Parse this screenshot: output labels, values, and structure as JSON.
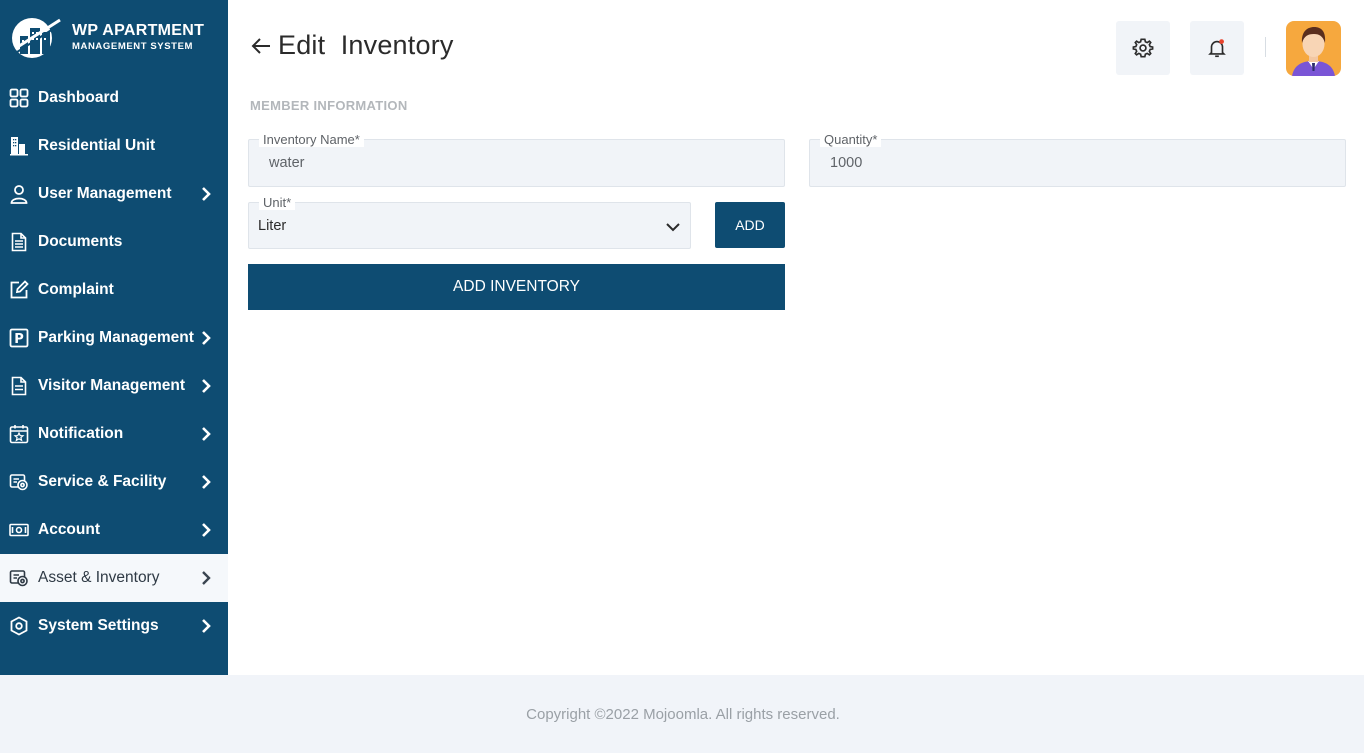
{
  "brand": {
    "title": "WP APARTMENT",
    "subtitle": "MANAGEMENT SYSTEM"
  },
  "sidebar": {
    "items": [
      {
        "label": "Dashboard",
        "icon": "dashboard-grid-icon",
        "has_submenu": false,
        "active": false
      },
      {
        "label": "Residential Unit",
        "icon": "building-icon",
        "has_submenu": false,
        "active": false
      },
      {
        "label": "User Management",
        "icon": "user-icon",
        "has_submenu": true,
        "active": false
      },
      {
        "label": "Documents",
        "icon": "document-icon",
        "has_submenu": false,
        "active": false
      },
      {
        "label": "Complaint",
        "icon": "edit-icon",
        "has_submenu": false,
        "active": false
      },
      {
        "label": "Parking Management",
        "icon": "parking-icon",
        "has_submenu": true,
        "active": false
      },
      {
        "label": "Visitor Management",
        "icon": "visitor-document-icon",
        "has_submenu": true,
        "active": false
      },
      {
        "label": "Notification",
        "icon": "calendar-star-icon",
        "has_submenu": true,
        "active": false
      },
      {
        "label": "Service & Facility",
        "icon": "service-icon",
        "has_submenu": true,
        "active": false
      },
      {
        "label": "Account",
        "icon": "money-icon",
        "has_submenu": true,
        "active": false
      },
      {
        "label": "Asset & Inventory",
        "icon": "asset-icon",
        "has_submenu": true,
        "active": true
      },
      {
        "label": "System Settings",
        "icon": "settings-hex-icon",
        "has_submenu": true,
        "active": false
      }
    ]
  },
  "header": {
    "title": "Edit  Inventory",
    "icons": [
      "gear-icon",
      "bell-icon"
    ],
    "bell_has_badge": true
  },
  "form": {
    "section_title": "MEMBER INFORMATION",
    "inventory_name": {
      "label": "Inventory Name*",
      "value": "water"
    },
    "quantity": {
      "label": "Quantity*",
      "value": "1000"
    },
    "unit": {
      "label": "Unit*",
      "value": "Liter"
    },
    "add_button": "ADD",
    "submit_button": "ADD INVENTORY"
  },
  "footer": {
    "copyright": "Copyright ©2022 Mojoomla. All rights reserved."
  },
  "colors": {
    "primary": "#0e4c72",
    "field_bg": "#f1f4f8",
    "active_item_bg": "#f5f8fb",
    "badge": "#e8442e",
    "avatar_bg": "#f6a83e"
  }
}
